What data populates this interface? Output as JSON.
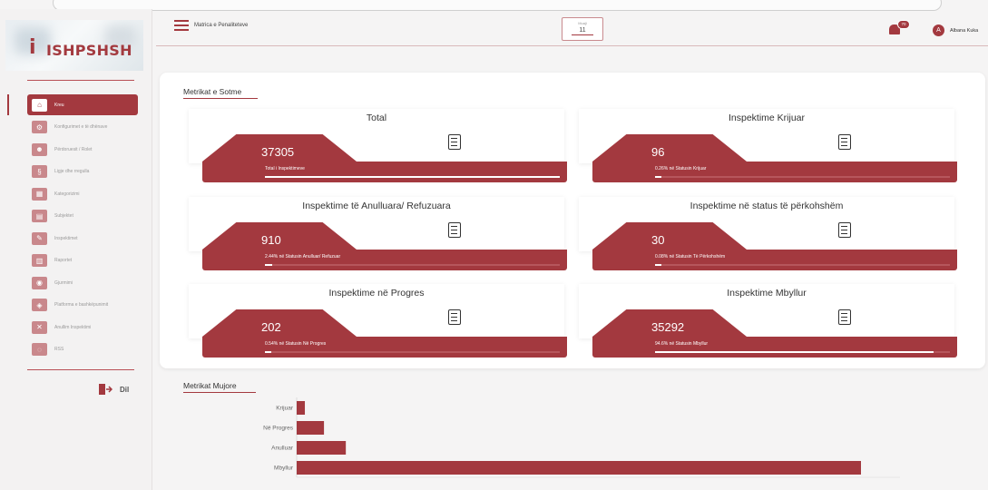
{
  "app": {
    "logo_text": "ISHPSHSH",
    "logo_mark": "i"
  },
  "sidebar": {
    "items": [
      {
        "label": "Kreu",
        "icon": "home-icon",
        "active": true
      },
      {
        "label": "Konfigurimet e të dhënave",
        "icon": "settings-icon",
        "active": false
      },
      {
        "label": "Përdoruesit / Rolet",
        "icon": "users-icon",
        "active": false
      },
      {
        "label": "Ligje dhe rregulla",
        "icon": "law-icon",
        "active": false
      },
      {
        "label": "Kategorizimi",
        "icon": "category-icon",
        "active": false
      },
      {
        "label": "Subjektet",
        "icon": "subjects-icon",
        "active": false
      },
      {
        "label": "Inspektimet",
        "icon": "inspection-icon",
        "active": false
      },
      {
        "label": "Raportet",
        "icon": "report-icon",
        "active": false
      },
      {
        "label": "Gjurmimi",
        "icon": "tracking-icon",
        "active": false
      },
      {
        "label": "Platforma e bashkëpunimit",
        "icon": "platform-icon",
        "active": false
      },
      {
        "label": "Anullim Inspektimi",
        "icon": "cancel-inspection-icon",
        "active": false
      },
      {
        "label": "RSS",
        "icon": "rss-icon",
        "active": false
      }
    ],
    "logout_label": "Dil"
  },
  "header": {
    "title": "Matrica e Penaliteteve",
    "month_label": "Muaji",
    "month_value": "11",
    "notification_count": "70",
    "user_name": "Albana Kuka",
    "user_initial": "A"
  },
  "today": {
    "section_title": "Metrikat e Sotme",
    "cards": [
      {
        "title": "Total",
        "value": "37305",
        "subtitle": "Total i Inspektimeve",
        "progress": 1.0
      },
      {
        "title": "Inspektime Krijuar",
        "value": "96",
        "subtitle": "0.26% në Statusin Krijuar",
        "progress": 0.0026
      },
      {
        "title": "Inspektime të Anulluara/ Refuzuara",
        "value": "910",
        "subtitle": "2.44% në Statusin Anulluar/ Refuzuar",
        "progress": 0.0244
      },
      {
        "title": "Inspektime në status të përkohshëm",
        "value": "30",
        "subtitle": "0.08% në Statusin Të Përkohshëm",
        "progress": 0.0008
      },
      {
        "title": "Inspektime në Progres",
        "value": "202",
        "subtitle": "0.54% në Statusin Në Progres",
        "progress": 0.0054
      },
      {
        "title": "Inspektime Mbyllur",
        "value": "35292",
        "subtitle": "94.6% në Statusin Mbyllur",
        "progress": 0.946
      }
    ]
  },
  "monthly": {
    "section_title": "Metrikat Mujore"
  },
  "colors": {
    "accent": "#a3393f",
    "background": "#f5f4f4"
  },
  "chart_data": {
    "type": "bar",
    "orientation": "horizontal",
    "categories": [
      "Krijuar",
      "Në Progres",
      "Anulluar",
      "Mbyllur"
    ],
    "values": [
      9,
      30,
      54,
      620
    ],
    "title": "",
    "xlabel": "",
    "ylabel": "",
    "grid": false
  }
}
